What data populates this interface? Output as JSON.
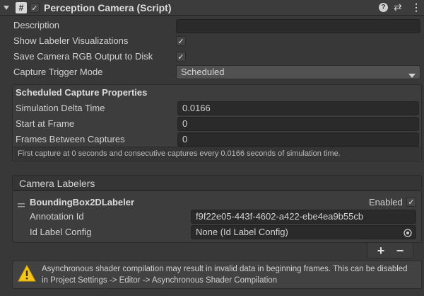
{
  "component": {
    "title": "Perception Camera (Script)",
    "hash_glyph": "#",
    "help_glyph": "?",
    "presets_glyph": "⇄",
    "menu_glyph": "⋮"
  },
  "fields": {
    "description_label": "Description",
    "description_value": "",
    "show_labeler_label": "Show Labeler Visualizations",
    "save_rgb_label": "Save Camera RGB Output to Disk",
    "capture_trigger_label": "Capture Trigger Mode",
    "capture_trigger_value": "Scheduled",
    "check_glyph": "✓"
  },
  "scheduled": {
    "title": "Scheduled Capture Properties",
    "delta_label": "Simulation Delta Time",
    "delta_value": "0.0166",
    "start_label": "Start at Frame",
    "start_value": "0",
    "between_label": "Frames Between Captures",
    "between_value": "0",
    "hint": "First capture at 0 seconds and consecutive captures every 0.0166 seconds of simulation time."
  },
  "labelers": {
    "title": "Camera Labelers",
    "item_name": "BoundingBox2DLabeler",
    "enabled_label": "Enabled",
    "annotation_label": "Annotation Id",
    "annotation_value": "f9f22e05-443f-4602-a422-ebe4ea9b55cb",
    "idconfig_label": "Id Label Config",
    "idconfig_value": "None (Id Label Config)",
    "add_glyph": "+",
    "remove_glyph": "−"
  },
  "warning": {
    "line1": "Asynchronous shader compilation may result in invalid data in beginning frames. This can be disabled",
    "line2": "in Project Settings -> Editor -> Asynchronous Shader Compilation"
  }
}
